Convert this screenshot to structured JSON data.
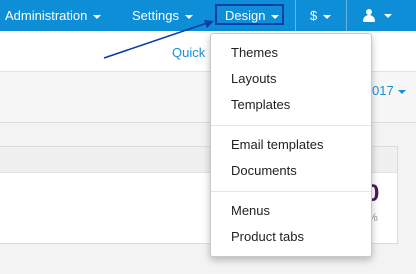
{
  "topbar": {
    "color": "#0e8ed6",
    "items": [
      {
        "label": "Administration"
      },
      {
        "label": "Settings"
      },
      {
        "label": "Design"
      },
      {
        "label": "$"
      }
    ],
    "user_icon": "user-icon"
  },
  "toolbar": {
    "quick_label": "Quick"
  },
  "filter": {
    "year_label": "017"
  },
  "stats": {
    "big_value": "0",
    "percent_label": "%"
  },
  "design_menu": {
    "groups": [
      [
        "Themes",
        "Layouts",
        "Templates"
      ],
      [
        "Email templates",
        "Documents"
      ],
      [
        "Menus",
        "Product tabs"
      ]
    ]
  },
  "annotation": {
    "highlight_color": "#0b3ea8"
  }
}
